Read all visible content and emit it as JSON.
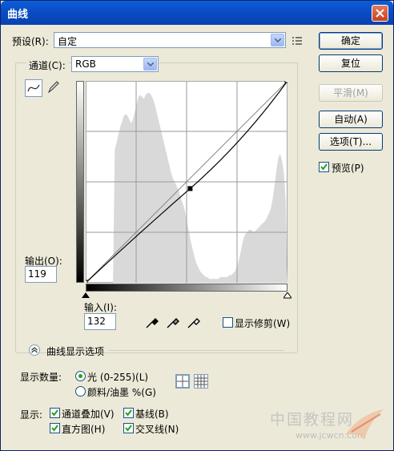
{
  "window": {
    "title": "曲线"
  },
  "preset": {
    "label": "预设(R):",
    "value": "自定"
  },
  "channel": {
    "label": "通道(C):",
    "value": "RGB"
  },
  "buttons": {
    "ok": "确定",
    "reset": "复位",
    "smooth": "平滑(M)",
    "auto": "自动(A)",
    "options": "选项(T)..."
  },
  "preview": {
    "label": "预览(P)",
    "checked": true
  },
  "output": {
    "label": "输出(O):",
    "value": "119"
  },
  "input": {
    "label": "输入(I):",
    "value": "132"
  },
  "show_clipping": {
    "label": "显示修剪(W)",
    "checked": false
  },
  "display_options": {
    "label": "曲线显示选项"
  },
  "show_amount": {
    "label": "显示数量:",
    "options": [
      {
        "label": "光 (0-255)(L)",
        "selected": true
      },
      {
        "label": "颜料/油墨 %(G)",
        "selected": false
      }
    ]
  },
  "show": {
    "label": "显示:",
    "items": [
      {
        "label": "通道叠加(V)",
        "checked": true
      },
      {
        "label": "基线(B)",
        "checked": true
      },
      {
        "label": "直方图(H)",
        "checked": true
      },
      {
        "label": "交叉线(N)",
        "checked": true
      }
    ]
  },
  "watermark": {
    "line1": "中国教程网",
    "line2": "www.jcwcn.com"
  },
  "curve": {
    "input": 132,
    "output": 119,
    "max": 255
  },
  "histogram": [
    0,
    0,
    0,
    0,
    0,
    0,
    0,
    0,
    0,
    0,
    0,
    0,
    0,
    0,
    0,
    0,
    70,
    74,
    78,
    82,
    85,
    88,
    89,
    88,
    86,
    84,
    86,
    90,
    94,
    98,
    99,
    98,
    97,
    99,
    100,
    100,
    99,
    97,
    94,
    90,
    86,
    82,
    78,
    74,
    70,
    66,
    62,
    58,
    55,
    53,
    51,
    49,
    46,
    43,
    40,
    36,
    31,
    26,
    21,
    17,
    13,
    10,
    8,
    6,
    5,
    4,
    3,
    3,
    2,
    2,
    2,
    2,
    2,
    2,
    3,
    3,
    3,
    3,
    3,
    4,
    4,
    5,
    6,
    8,
    11,
    15,
    20,
    24,
    26,
    27,
    28,
    28,
    27,
    27,
    28,
    29,
    30,
    31,
    32,
    33,
    35,
    37,
    40,
    45,
    52,
    60,
    66,
    68,
    64,
    58,
    44,
    0
  ]
}
